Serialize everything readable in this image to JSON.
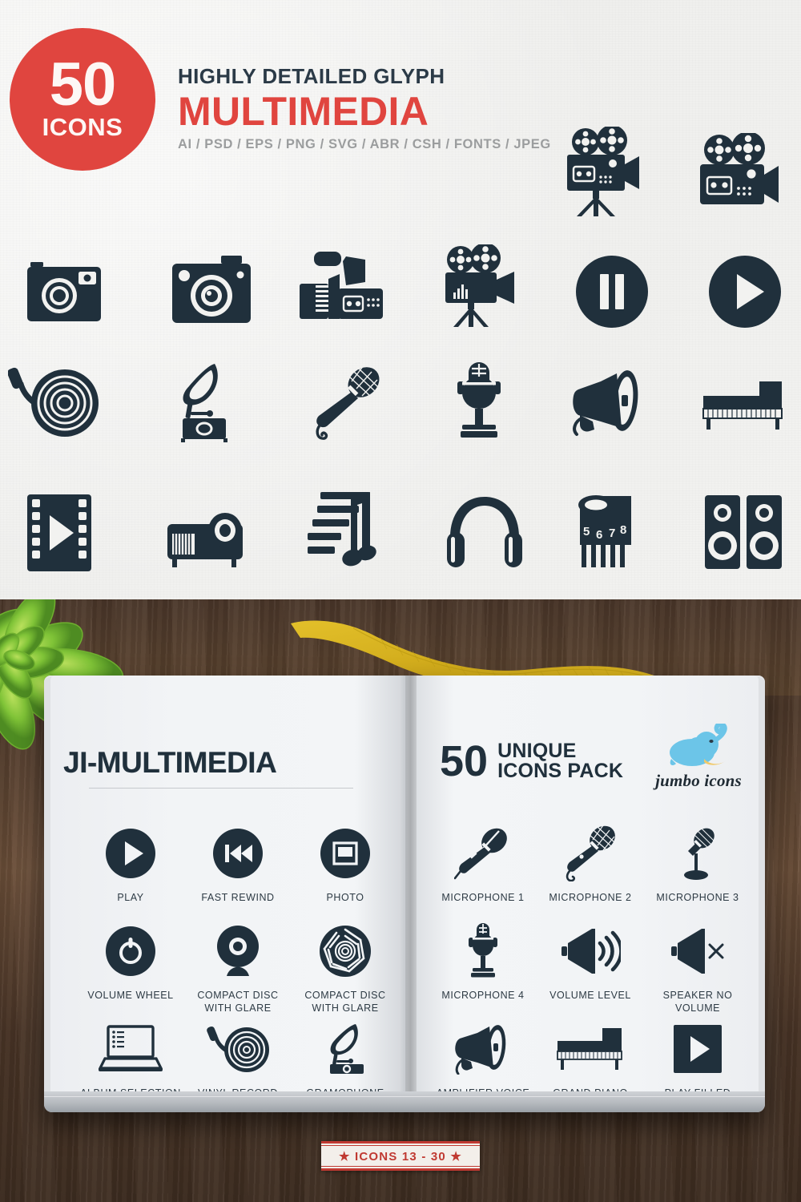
{
  "colors": {
    "accent_red": "#e0453f",
    "icon_navy": "#20303c",
    "paper": "#f2f2f0",
    "wood": "#5a4331",
    "elephant_blue": "#6cc5e8",
    "badge_red": "#c03a32"
  },
  "header": {
    "badge_number": "50",
    "badge_word": "ICONS",
    "kicker": "HIGHLY DETAILED GLYPH",
    "title": "MULTIMEDIA",
    "formats": "AI / PSD / EPS / PNG / SVG / ABR / CSH / FONTS / JPEG"
  },
  "top_icons": [
    {
      "name": "movie-camera-tripod-icon"
    },
    {
      "name": "movie-camera-icon"
    },
    {
      "name": "photo-camera-icon"
    },
    {
      "name": "vintage-camera-icon"
    },
    {
      "name": "video-camcorder-icon"
    },
    {
      "name": "film-projector-camera-icon"
    },
    {
      "name": "pause-circle-icon"
    },
    {
      "name": "play-circle-icon"
    },
    {
      "name": "vinyl-record-player-icon"
    },
    {
      "name": "gramophone-icon"
    },
    {
      "name": "microphone-handheld-icon"
    },
    {
      "name": "studio-microphone-icon"
    },
    {
      "name": "megaphone-icon"
    },
    {
      "name": "grand-piano-icon"
    },
    {
      "name": "film-strip-play-icon"
    },
    {
      "name": "video-projector-icon"
    },
    {
      "name": "music-notes-icon"
    },
    {
      "name": "headphones-icon"
    },
    {
      "name": "film-reel-numbers-icon"
    },
    {
      "name": "speakers-icon"
    }
  ],
  "notebook": {
    "left_page": {
      "title": "JI-MULTIMEDIA",
      "icons": [
        {
          "label": "PLAY",
          "name": "play-circle-icon"
        },
        {
          "label": "FAST REWIND",
          "name": "fast-rewind-icon"
        },
        {
          "label": "PHOTO",
          "name": "photo-square-icon"
        },
        {
          "label": "VOLUME WHEEL",
          "name": "volume-wheel-icon"
        },
        {
          "label": "COMPACT DISC\nWITH GLARE",
          "name": "compact-disc-glare-icon"
        },
        {
          "label": "COMPACT DISC\nWITH GLARE",
          "name": "compact-disc-glare-alt-icon"
        },
        {
          "label": "ALBUM SELECTION\nLAPTOP",
          "name": "album-selection-laptop-icon"
        },
        {
          "label": "VINYL RECORD\nPLAYER",
          "name": "vinyl-record-player-icon"
        },
        {
          "label": "GRAMOPHONE",
          "name": "gramophone-icon"
        }
      ]
    },
    "right_page": {
      "count": "50",
      "headline_line1": "UNIQUE",
      "headline_line2": "ICONS PACK",
      "brand": "jumbo icons",
      "icons": [
        {
          "label": "MICROPHONE 1",
          "name": "microphone-1-icon"
        },
        {
          "label": "MICROPHONE 2",
          "name": "microphone-2-icon"
        },
        {
          "label": "MICROPHONE 3",
          "name": "microphone-3-icon"
        },
        {
          "label": "MICROPHONE 4",
          "name": "microphone-4-icon"
        },
        {
          "label": "VOLUME LEVEL",
          "name": "volume-level-icon"
        },
        {
          "label": "SPEAKER NO\nVOLUME",
          "name": "speaker-no-volume-icon"
        },
        {
          "label": "AMPLIFIER VOICE",
          "name": "amplifier-voice-icon"
        },
        {
          "label": "GRAND PIANO",
          "name": "grand-piano-icon"
        },
        {
          "label": "PLAY FILLED\nSQUARE BUTTON",
          "name": "play-filled-square-button-icon"
        }
      ]
    }
  },
  "footer_badge": {
    "text": "★ ICONS 13 - 30 ★"
  }
}
